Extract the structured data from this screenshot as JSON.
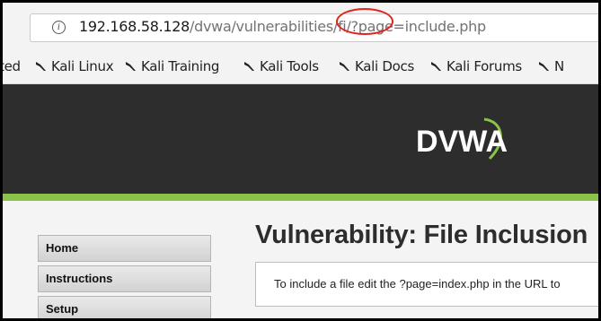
{
  "browser": {
    "url": {
      "host": "192.168.58.128",
      "path_before_query": "/dvwa/vulnerabilities/fi/",
      "query": "?page=include.php"
    },
    "bookmarks": [
      {
        "label": "ted",
        "icon": "none"
      },
      {
        "label": "Kali Linux",
        "icon": "kali-dragon-icon"
      },
      {
        "label": "Kali Training",
        "icon": "kali-dragon-icon"
      },
      {
        "label": "Kali Tools",
        "icon": "kali-dragon-icon"
      },
      {
        "label": "Kali Docs",
        "icon": "kali-dragon-icon"
      },
      {
        "label": "Kali Forums",
        "icon": "kali-dragon-icon"
      },
      {
        "label": "N",
        "icon": "kali-dragon-icon"
      }
    ]
  },
  "header": {
    "logo_text": "DVWA",
    "accent_color": "#8bc34a",
    "background_color": "#2d2d2d"
  },
  "sidebar": {
    "items": [
      {
        "label": "Home"
      },
      {
        "label": "Instructions"
      },
      {
        "label": "Setup"
      }
    ]
  },
  "main": {
    "title": "Vulnerability: File Inclusion",
    "notice": "To include a file edit the ?page=index.php in the URL to"
  },
  "annotation": {
    "color": "#e0231d",
    "shape": "ellipse"
  }
}
